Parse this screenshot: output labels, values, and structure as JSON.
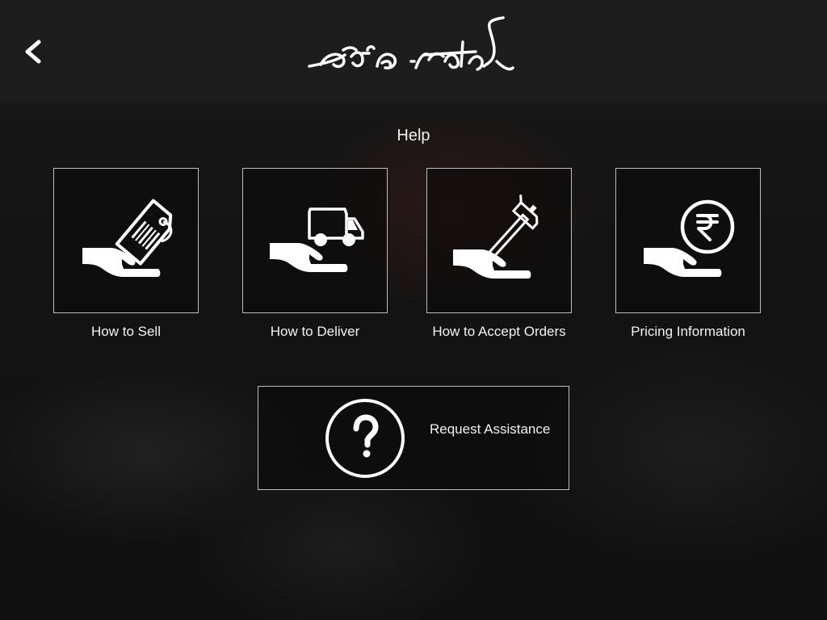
{
  "header": {
    "logo_text": "কাঁহিৰ শৰাই"
  },
  "page": {
    "title": "Help"
  },
  "tiles": [
    {
      "label": "How to Sell",
      "icon": "hand-price-tag-icon"
    },
    {
      "label": "How to Deliver",
      "icon": "hand-delivery-truck-icon"
    },
    {
      "label": "How to Accept Orders",
      "icon": "hand-hammer-icon"
    },
    {
      "label": "Pricing Information",
      "icon": "hand-rupee-coin-icon"
    }
  ],
  "assistance": {
    "label": "Request Assistance",
    "icon": "question-mark-circle-icon"
  },
  "colors": {
    "background": "#141414",
    "header": "#1e1e1e",
    "border": "#bdbdbd",
    "text": "#ffffff"
  }
}
